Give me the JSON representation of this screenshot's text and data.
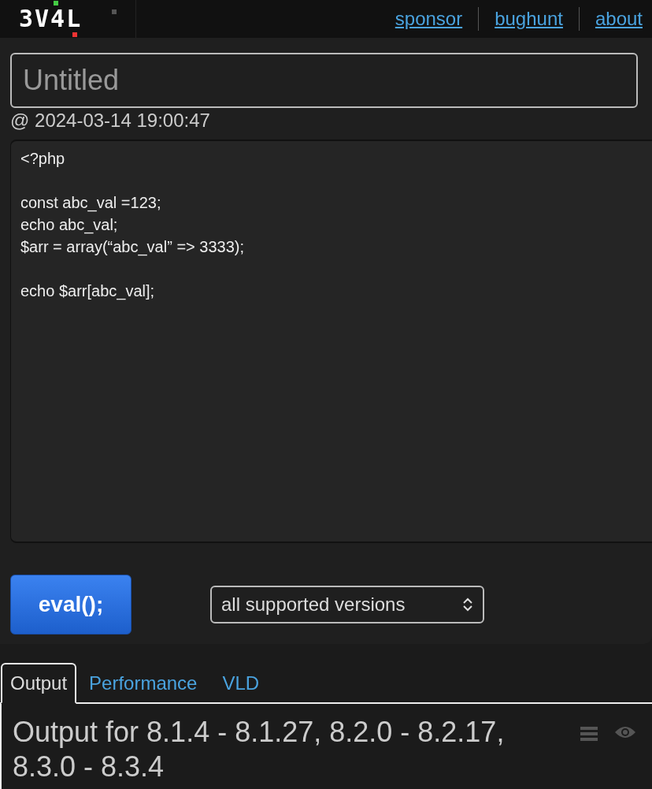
{
  "header": {
    "logo": "3V4L",
    "links": [
      "sponsor",
      "bughunt",
      "about"
    ]
  },
  "title_field": {
    "placeholder": "Untitled"
  },
  "timestamp": "@ 2024-03-14 19:00:47",
  "code": "<?php\n\nconst abc_val =123;\necho abc_val;\n$arr = array(“abc_val” => 3333);\n\necho $arr[abc_val];",
  "eval_button": "eval();",
  "version_select": {
    "value": "all supported versions"
  },
  "tabs": [
    {
      "label": "Output",
      "selected": true
    },
    {
      "label": "Performance",
      "selected": false
    },
    {
      "label": "VLD",
      "selected": false
    }
  ],
  "output": {
    "heading": "Output for 8.1.4 - 8.1.27, 8.2.0 - 8.2.17, 8.3.0 - 8.3.4"
  }
}
